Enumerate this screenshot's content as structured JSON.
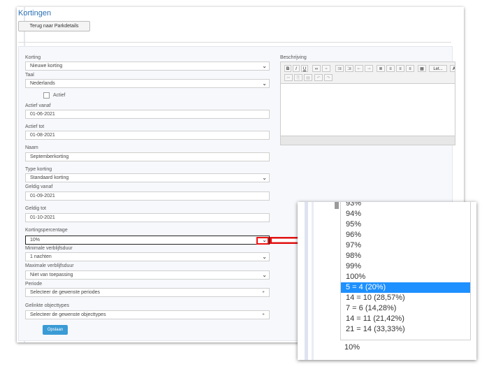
{
  "page": {
    "title": "Kortingen",
    "back_button": "Terug naar Parkdetails",
    "save_button": "Opslaan"
  },
  "form": {
    "korting": {
      "label": "Korting",
      "value": "Nieuwe korting"
    },
    "taal": {
      "label": "Taal",
      "value": "Nederlands"
    },
    "actief": {
      "label": "Actief"
    },
    "actief_vanaf": {
      "label": "Actief vanaf",
      "value": "01-06-2021"
    },
    "actief_tot": {
      "label": "Actief tot",
      "value": "01-08-2021"
    },
    "naam": {
      "label": "Naam",
      "value": "Septemberkorting"
    },
    "type_korting": {
      "label": "Type korting",
      "value": "Standaard korting"
    },
    "geldig_vanaf": {
      "label": "Geldig vanaf",
      "value": "01-09-2021"
    },
    "geldig_tot": {
      "label": "Geldig tot",
      "value": "01-10-2021"
    },
    "kortingspercentage": {
      "label": "Kortingspercentage",
      "value": "10%"
    },
    "min_verblijf": {
      "label": "Minimale verblijfsduur",
      "value": "1 nachten"
    },
    "max_verblijf": {
      "label": "Maximale verblijfsduur",
      "value": "Niet van toepassing"
    },
    "periode": {
      "label": "Periode",
      "placeholder": "Selecteer de gewenste periodes"
    },
    "objecttypes": {
      "label": "Gelinkte objecttypes",
      "placeholder": "Selecteer de gewenste objecttypes"
    }
  },
  "editor": {
    "label": "Beschrijving",
    "toolbar_row1": [
      "B",
      "I",
      "U",
      "∞",
      "⚭",
      "⁝≡",
      "⁚≡",
      "⇤",
      "⇥",
      "≣",
      "≡",
      "≡",
      "≡",
      "▦",
      "Let...",
      "A"
    ],
    "toolbar_row2": [
      "✂",
      "⎘",
      "▤",
      "↶",
      "↷"
    ]
  },
  "zoom_dropdown": {
    "partial_top": "93%",
    "options": [
      "94%",
      "95%",
      "96%",
      "97%",
      "98%",
      "99%",
      "100%",
      "5 = 4 (20%)",
      "14 = 10 (28,57%)",
      "7 = 6 (14,28%)",
      "14 = 11 (21,42%)",
      "21 = 14 (33,33%)"
    ],
    "selected_index": 7,
    "current_value": "10%"
  },
  "colors": {
    "accent": "#2a6fb5",
    "selection": "#1e90ff",
    "save_button": "#3a9bd5",
    "annotation": "#e11111"
  }
}
